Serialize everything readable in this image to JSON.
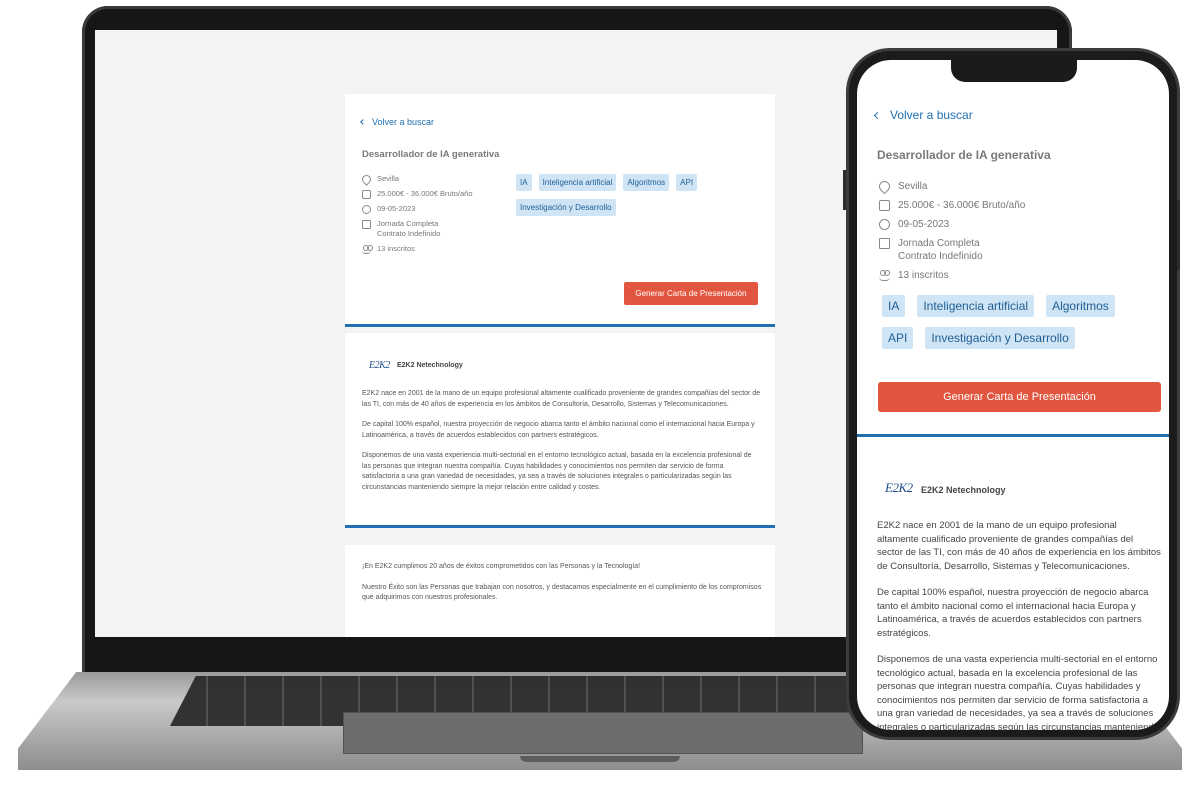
{
  "job": {
    "back_label": "Volver a buscar",
    "title": "Desarrollador de IA generativa",
    "location": "Sevilla",
    "salary": "25.000€ - 36.000€ Bruto/año",
    "date": "09-05-2023",
    "schedule": "Jornada Completa",
    "contract": "Contrato Indefinido",
    "applicants": "13 inscritos",
    "tags": [
      "IA",
      "Inteligencia artificial",
      "Algoritmos",
      "API",
      "Investigación y Desarrollo"
    ],
    "cta_label": "Generar Carta de Presentación"
  },
  "company": {
    "logo_text": "E2K2",
    "name": "E2K2 Netechnology",
    "paragraphs": [
      "E2K2 nace en 2001 de la mano de un equipo profesional altamente cualificado proveniente de grandes compañías del sector de las TI, con más de 40 años de experiencia en los ámbitos de Consultoría, Desarrollo, Sistemas y Telecomunicaciones.",
      "De capital 100% español, nuestra proyección de negocio abarca tanto el ámbito nacional como el internacional hacia Europa y Latinoamérica, a través de acuerdos establecidos con partners estratégicos.",
      "Disponemos de una vasta experiencia multi-sectorial en el entorno tecnológico actual, basada en la excelencia profesional de las personas que integran nuestra compañía. Cuyas habilidades y conocimientos nos permiten dar servicio de forma satisfactoria a una gran variedad de necesidades, ya sea a través de soluciones integrales o particularizadas según las circunstancias manteniendo siempre la mejor relación entre calidad y costes."
    ]
  },
  "extra": {
    "paragraphs": [
      "¡En E2K2 cumplimos 20 años de éxitos comprometidos con las Personas y la Tecnología!",
      "Nuestro Éxito son las Personas que trabajan con nosotros, y destacamos especialmente en el cumplimiento de los compromisos que adquirimos con nuestros profesionales."
    ]
  },
  "colors": {
    "accent": "#1f6fb2",
    "cta": "#e2563f",
    "tag_bg": "#cfe4f4"
  }
}
